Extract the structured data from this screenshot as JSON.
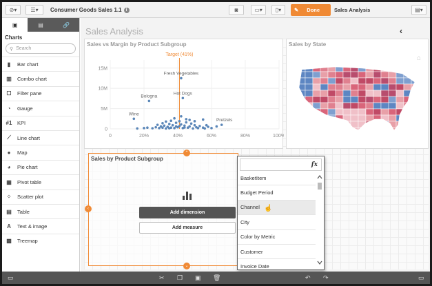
{
  "toolbar": {
    "compass_icon": "compass-icon",
    "menu_icon": "menu-icon",
    "app_title": "Consumer Goods Sales 1.1",
    "info_icon": "i",
    "snapshot_icon": "camera-icon",
    "present_icon": "presentation-icon",
    "bookmark_icon": "bookmark-icon",
    "done_label": "Done",
    "sheet_name": "Sales Analysis",
    "sheets_icon": "sheets-icon"
  },
  "left_panel": {
    "tabs": [
      "charts-tab",
      "fields-tab",
      "master-items-tab"
    ],
    "heading": "Charts",
    "search_placeholder": "Search",
    "items": [
      {
        "label": "Bar chart",
        "icon": "bar-chart-icon",
        "glyph": "▮"
      },
      {
        "label": "Combo chart",
        "icon": "combo-chart-icon",
        "glyph": "▥"
      },
      {
        "label": "Filter pane",
        "icon": "filter-pane-icon",
        "glyph": "☐"
      },
      {
        "label": "Gauge",
        "icon": "gauge-icon",
        "glyph": "◔"
      },
      {
        "label": "KPI",
        "icon": "kpi-icon",
        "glyph": "#1"
      },
      {
        "label": "Line chart",
        "icon": "line-chart-icon",
        "glyph": "⟋"
      },
      {
        "label": "Map",
        "icon": "map-icon",
        "glyph": "●"
      },
      {
        "label": "Pie chart",
        "icon": "pie-chart-icon",
        "glyph": "◕"
      },
      {
        "label": "Pivot table",
        "icon": "pivot-table-icon",
        "glyph": "▦"
      },
      {
        "label": "Scatter plot",
        "icon": "scatter-plot-icon",
        "glyph": "⁘"
      },
      {
        "label": "Table",
        "icon": "table-icon",
        "glyph": "▤"
      },
      {
        "label": "Text & image",
        "icon": "text-image-icon",
        "glyph": "A"
      },
      {
        "label": "Treemap",
        "icon": "treemap-icon",
        "glyph": "▩"
      }
    ]
  },
  "main": {
    "sheet_title": "Sales Analysis",
    "scatter_panel": {
      "title": "Sales vs Margin by Product Subgroup"
    },
    "map_panel": {
      "title": "Sales by State",
      "home_icon": "home-icon"
    },
    "selected_panel": {
      "title": "Sales by Product Subgroup",
      "add_dimension": "Add dimension",
      "add_measure": "Add measure"
    }
  },
  "dropdown": {
    "fx_label": "fx",
    "items": [
      "BasketItem",
      "Budget Period",
      "Channel",
      "City",
      "Color by Metric",
      "Customer",
      "Invoice Date"
    ],
    "hover_index": 2
  },
  "chart_data": {
    "type": "scatter",
    "title": "Sales vs Margin by Product Subgroup",
    "xlabel": "",
    "ylabel": "",
    "x_ticks": [
      "0",
      "20%",
      "40%",
      "60%",
      "80%",
      "100%"
    ],
    "y_ticks": [
      "0",
      "5M",
      "10M",
      "15M"
    ],
    "xlim": [
      0,
      1
    ],
    "ylim": [
      0,
      17000000
    ],
    "reference_line": {
      "label": "Target (41%)",
      "x": 0.41
    },
    "labeled_points": [
      {
        "label": "Fresh Vegetables",
        "x": 0.42,
        "y": 12500000
      },
      {
        "label": "Bologna",
        "x": 0.23,
        "y": 6900000
      },
      {
        "label": "Hot Dogs",
        "x": 0.43,
        "y": 7600000
      },
      {
        "label": "Wine",
        "x": 0.14,
        "y": 2500000
      },
      {
        "label": "Pretzels",
        "x": 0.66,
        "y": 1000000
      }
    ],
    "points": [
      [
        0.16,
        0.1
      ],
      [
        0.2,
        0.2
      ],
      [
        0.22,
        0.3
      ],
      [
        0.25,
        0.15
      ],
      [
        0.27,
        0.4
      ],
      [
        0.29,
        0.2
      ],
      [
        0.3,
        0.6
      ],
      [
        0.31,
        0.3
      ],
      [
        0.32,
        0.8
      ],
      [
        0.33,
        0.1
      ],
      [
        0.34,
        0.5
      ],
      [
        0.35,
        1.2
      ],
      [
        0.36,
        0.3
      ],
      [
        0.37,
        0.9
      ],
      [
        0.38,
        0.2
      ],
      [
        0.39,
        1.5
      ],
      [
        0.4,
        0.4
      ],
      [
        0.41,
        0.7
      ],
      [
        0.42,
        1.1
      ],
      [
        0.43,
        0.2
      ],
      [
        0.44,
        0.8
      ],
      [
        0.45,
        1.6
      ],
      [
        0.46,
        0.3
      ],
      [
        0.47,
        0.6
      ],
      [
        0.48,
        1.3
      ],
      [
        0.49,
        0.1
      ],
      [
        0.5,
        0.9
      ],
      [
        0.51,
        0.4
      ],
      [
        0.52,
        0.2
      ],
      [
        0.53,
        0.7
      ],
      [
        0.55,
        0.3
      ],
      [
        0.56,
        0.1
      ],
      [
        0.58,
        0.5
      ],
      [
        0.6,
        0.2
      ],
      [
        0.38,
        2.6
      ],
      [
        0.33,
        1.8
      ],
      [
        0.45,
        2.4
      ],
      [
        0.28,
        1.0
      ],
      [
        0.36,
        2.0
      ],
      [
        0.5,
        1.9
      ],
      [
        0.42,
        3.1
      ],
      [
        0.31,
        1.4
      ],
      [
        0.47,
        2.2
      ],
      [
        0.39,
        0.6
      ],
      [
        0.35,
        0.15
      ],
      [
        0.44,
        0.35
      ],
      [
        0.41,
        1.9
      ],
      [
        0.57,
        0.9
      ],
      [
        0.55,
        2.3
      ],
      [
        0.63,
        0.6
      ]
    ]
  },
  "map_data": {
    "colors": [
      "#d9657a",
      "#e0808f",
      "#c04a66",
      "#e8a0a8",
      "#7f9fcf",
      "#5d86c2",
      "#f0c0c8",
      "#b84d6e"
    ]
  },
  "bottombar": {
    "icons": [
      "sheet-icon",
      "cut-icon",
      "copy-icon",
      "paste-icon",
      "delete-icon",
      "undo-icon",
      "redo-icon",
      "expand-icon"
    ]
  }
}
